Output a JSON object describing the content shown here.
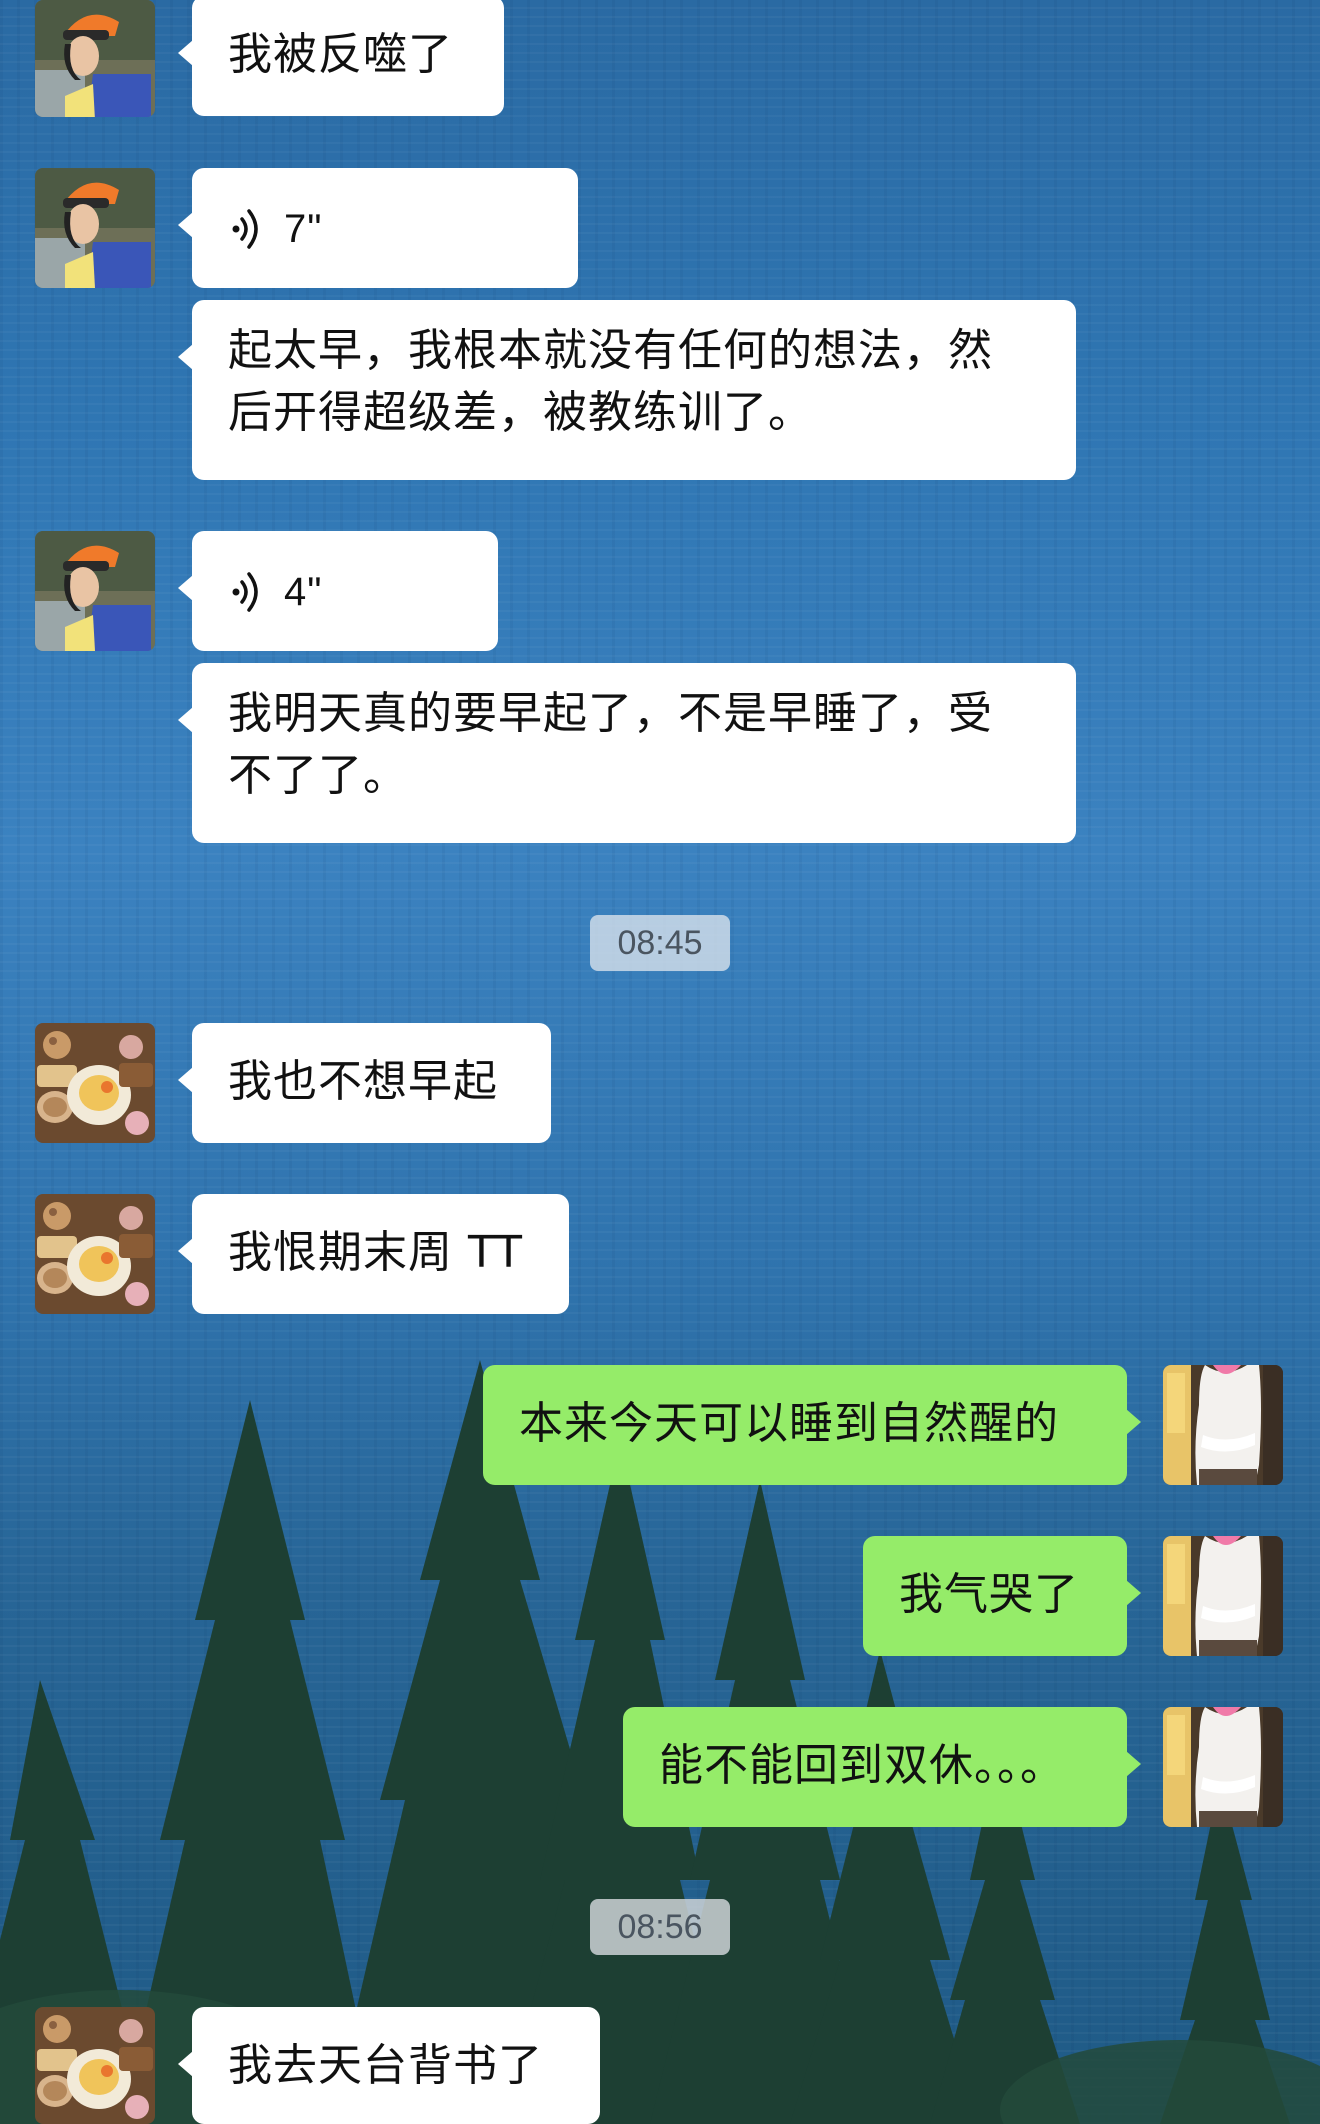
{
  "colors": {
    "sent_bubble": "#95ec69",
    "received_bubble": "#ffffff"
  },
  "messages": [
    {
      "sender": "friend_a",
      "type": "text",
      "text": "我被反噬了"
    },
    {
      "sender": "friend_a",
      "type": "voice",
      "icon": "voice-wave-icon",
      "duration": "7\""
    },
    {
      "sender": "friend_a",
      "type": "text",
      "lines": [
        "起太早，我根本就没有任何的想法，然",
        "后开得超级差，被教练训了。"
      ]
    },
    {
      "sender": "friend_a",
      "type": "voice",
      "icon": "voice-wave-icon",
      "duration": "4\""
    },
    {
      "sender": "friend_a",
      "type": "text",
      "lines": [
        "我明天真的要早起了，不是早睡了，受",
        "不了了。"
      ]
    },
    {
      "sender": "friend_b",
      "type": "text",
      "text": "我也不想早起"
    },
    {
      "sender": "friend_b",
      "type": "text",
      "text": "我恨期末周 TT"
    },
    {
      "sender": "me",
      "type": "text",
      "text": "本来今天可以睡到自然醒的"
    },
    {
      "sender": "me",
      "type": "text",
      "text": "我气哭了"
    },
    {
      "sender": "me",
      "type": "text",
      "text": "能不能回到双休。。。"
    },
    {
      "sender": "friend_b",
      "type": "text",
      "text": "我去天台背书了"
    }
  ],
  "timestamps": [
    "08:45",
    "08:56"
  ]
}
